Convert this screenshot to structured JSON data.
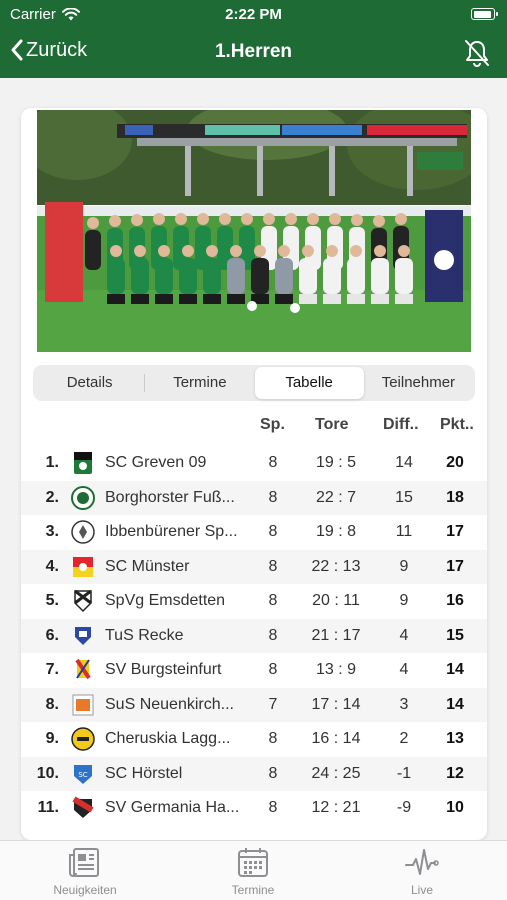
{
  "status_bar": {
    "carrier": "Carrier",
    "time": "2:22 PM"
  },
  "nav": {
    "back_label": "Zurück",
    "title": "1.Herren"
  },
  "tabs": [
    {
      "label": "Details",
      "active": false
    },
    {
      "label": "Termine",
      "active": false
    },
    {
      "label": "Tabelle",
      "active": true
    },
    {
      "label": "Teilnehmer",
      "active": false
    }
  ],
  "table": {
    "columns": {
      "sp": "Sp.",
      "tore": "Tore",
      "diff": "Diff..",
      "pkt": "Pkt.."
    },
    "rows": [
      {
        "rank": "1.",
        "team": "SC Greven 09",
        "sp": "8",
        "tore": "19 : 5",
        "diff": "14",
        "pkt": "20",
        "logo_icon": "sc-greven-logo"
      },
      {
        "rank": "2.",
        "team": "Borghorster Fuß...",
        "sp": "8",
        "tore": "22 : 7",
        "diff": "15",
        "pkt": "18",
        "logo_icon": "borghorst-logo"
      },
      {
        "rank": "3.",
        "team": "Ibbenbürener Sp...",
        "sp": "8",
        "tore": "19 : 8",
        "diff": "11",
        "pkt": "17",
        "logo_icon": "ibbenbueren-logo"
      },
      {
        "rank": "4.",
        "team": "SC Münster",
        "sp": "8",
        "tore": "22 : 13",
        "diff": "9",
        "pkt": "17",
        "logo_icon": "sc-muenster-logo"
      },
      {
        "rank": "5.",
        "team": "SpVg Emsdetten",
        "sp": "8",
        "tore": "20 : 11",
        "diff": "9",
        "pkt": "16",
        "logo_icon": "emsdetten-logo"
      },
      {
        "rank": "6.",
        "team": "TuS Recke",
        "sp": "8",
        "tore": "21 : 17",
        "diff": "4",
        "pkt": "15",
        "logo_icon": "tus-recke-logo"
      },
      {
        "rank": "7.",
        "team": "SV Burgsteinfurt",
        "sp": "8",
        "tore": "13 : 9",
        "diff": "4",
        "pkt": "14",
        "logo_icon": "burgsteinfurt-logo"
      },
      {
        "rank": "8.",
        "team": "SuS Neuenkirch...",
        "sp": "7",
        "tore": "17 : 14",
        "diff": "3",
        "pkt": "14",
        "logo_icon": "neuenkirchen-logo"
      },
      {
        "rank": "9.",
        "team": "Cheruskia Lagg...",
        "sp": "8",
        "tore": "16 : 14",
        "diff": "2",
        "pkt": "13",
        "logo_icon": "cheruskia-logo"
      },
      {
        "rank": "10.",
        "team": "SC Hörstel",
        "sp": "8",
        "tore": "24 : 25",
        "diff": "-1",
        "pkt": "12",
        "logo_icon": "hoerstel-logo"
      },
      {
        "rank": "11.",
        "team": "SV Germania Ha...",
        "sp": "8",
        "tore": "12 : 21",
        "diff": "-9",
        "pkt": "10",
        "logo_icon": "germania-logo"
      }
    ]
  },
  "tab_bar": [
    {
      "label": "Neuigkeiten",
      "icon": "newspaper-icon"
    },
    {
      "label": "Termine",
      "icon": "calendar-icon"
    },
    {
      "label": "Live",
      "icon": "pulse-icon"
    }
  ],
  "colors": {
    "primary": "#1f6b35",
    "tab_inactive": "#8e8e93"
  }
}
